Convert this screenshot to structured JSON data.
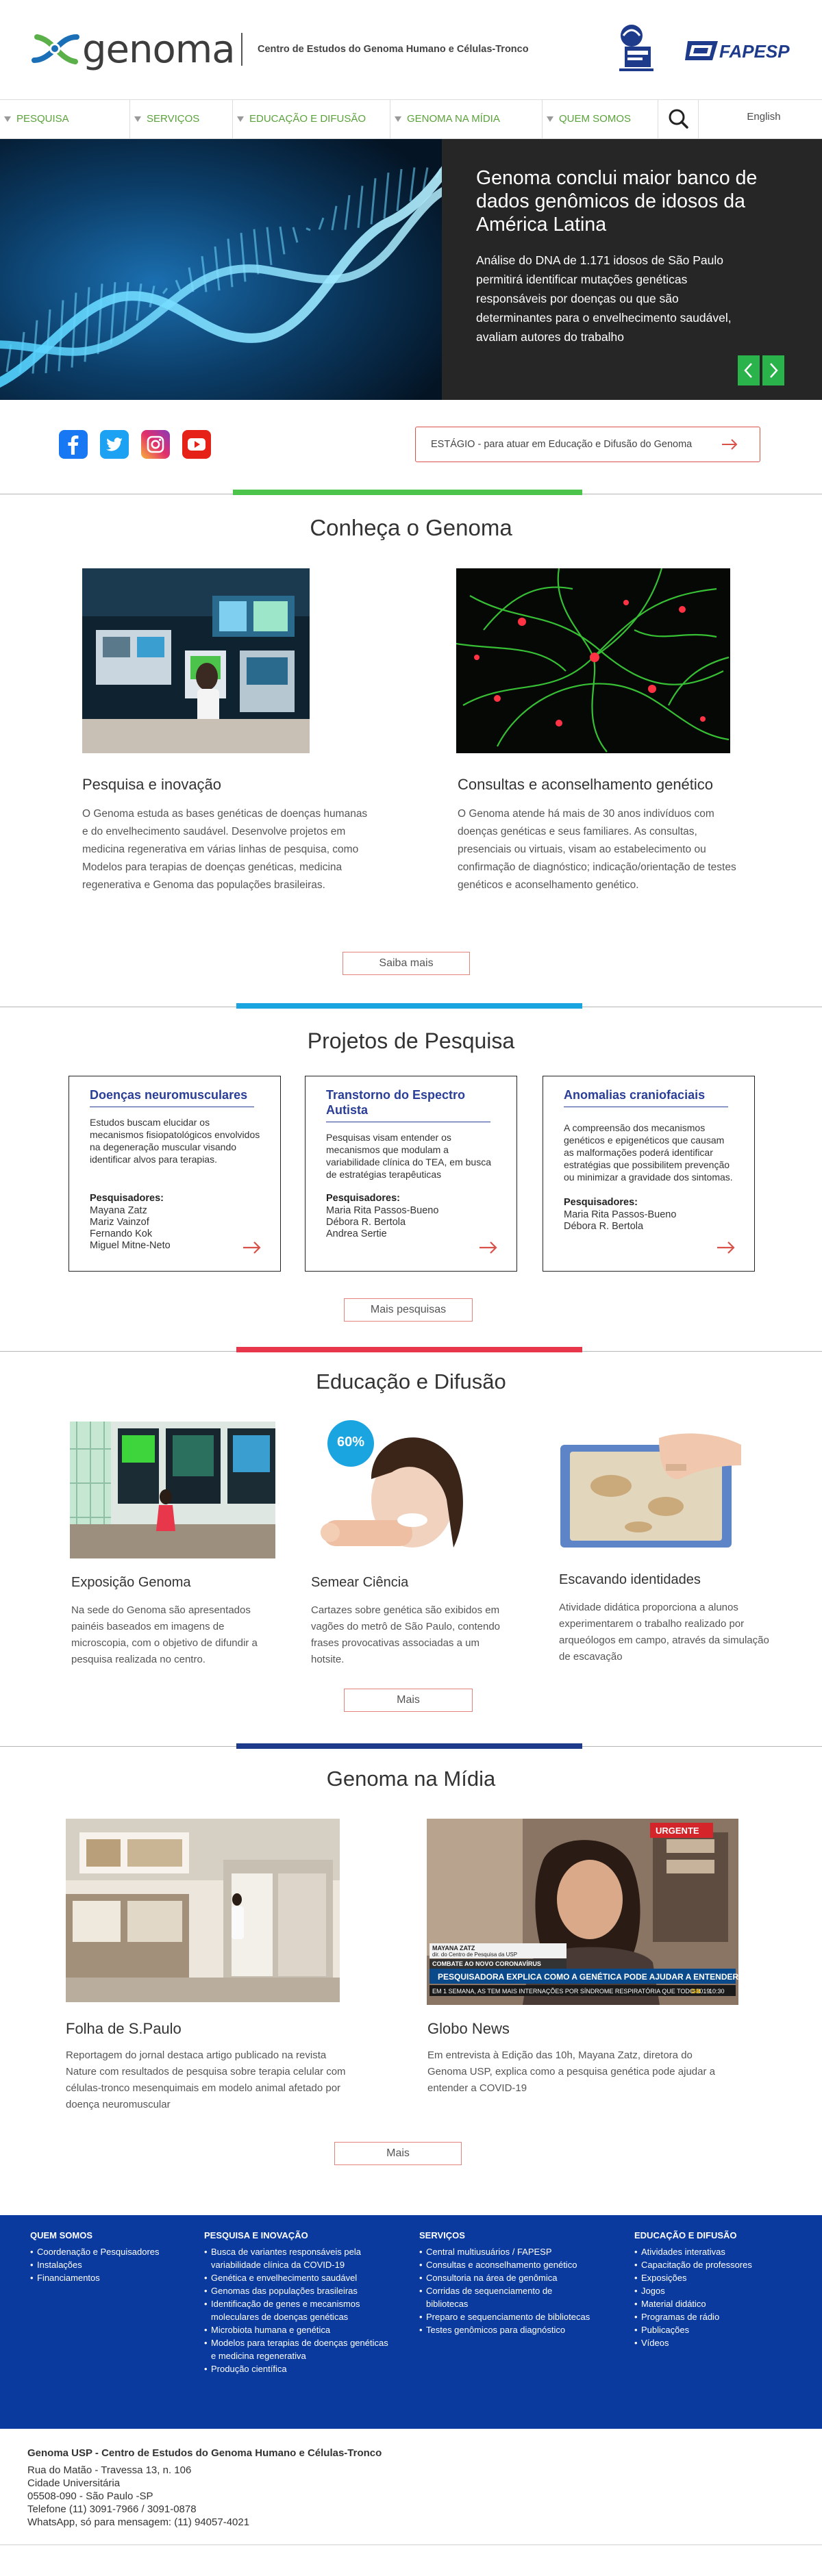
{
  "header": {
    "logo_text": "genoma",
    "center_name": "Centro de Estudos do Genoma Humano e Células-Tronco",
    "partner_logo": "institution-seal-logo",
    "fapesp_text": "FAPESP"
  },
  "nav": {
    "items": [
      "PESQUISA",
      "SERVIÇOS",
      "EDUCAÇÃO E DIFUSÃO",
      "GENOMA NA MÍDIA",
      "QUEM SOMOS"
    ],
    "language": "English",
    "search_icon": "search-icon"
  },
  "hero": {
    "title": "Genoma conclui maior banco de dados genômicos de idosos da América Latina",
    "text": "Análise do DNA de 1.171 idosos de São Paulo permitirá identificar mutações genéticas responsáveis por doenças ou que são determinantes para o envelhecimento saudável, avaliam autores do trabalho",
    "prev_icon": "chevron-left-icon",
    "next_icon": "chevron-right-icon"
  },
  "social": {
    "icons": [
      "facebook-icon",
      "twitter-icon",
      "instagram-icon",
      "youtube-icon"
    ],
    "estagio_label": "ESTÁGIO - para atuar em Educação e Difusão do Genoma"
  },
  "conheca": {
    "title": "Conheça o Genoma",
    "bar_color": "#4cc34a",
    "cards": [
      {
        "title": "Pesquisa e inovação",
        "text": "O Genoma estuda as bases genéticas de doenças humanas e do envelhecimento saudável. Desenvolve projetos em medicina regenerativa em várias linhas de pesquisa, como Modelos para terapias de doenças genéticas, medicina regenerativa e Genoma das populações brasileiras."
      },
      {
        "title": "Consultas e aconselhamento genético",
        "text": "O Genoma atende há mais de 30 anos indivíduos com doenças genéticas e seus familiares. As consultas, presenciais ou virtuais, visam ao estabelecimento ou confirmação de diagnóstico; indicação/orientação de testes genéticos e aconselhamento genético."
      }
    ],
    "more_label": "Saiba mais"
  },
  "projetos": {
    "title": "Projetos de Pesquisa",
    "bar_color": "#1aa5e0",
    "researchers_label": "Pesquisadores:",
    "cards": [
      {
        "title": "Doenças neuromusculares",
        "desc": "Estudos buscam elucidar os mecanismos fisiopatológicos envolvidos na degeneração muscular visando identificar alvos para terapias.",
        "names": [
          "Mayana Zatz",
          "Mariz  Vainzof",
          "Fernando Kok",
          "Miguel Mitne-Neto"
        ]
      },
      {
        "title": "Transtorno do Espectro Autista",
        "desc": "Pesquisas visam entender os mecanismos que modulam a variabilidade clínica do TEA, em busca de estratégias terapêuticas",
        "names": [
          "Maria Rita Passos-Bueno",
          "Débora R. Bertola",
          "Andrea Sertie"
        ]
      },
      {
        "title": "Anomalias craniofaciais",
        "desc": "A compreensão dos mecanismos genéticos e epigenéticos que causam as malformações poderá identificar estratégias que possibilitem prevenção ou minimizar a gravidade dos sintomas.",
        "names": [
          "Maria Rita Passos-Bueno",
          "Débora R. Bertola"
        ]
      }
    ],
    "more_label": "Mais pesquisas"
  },
  "educacao": {
    "title": "Educação e Difusão",
    "bar_color": "#e8374a",
    "cards": [
      {
        "title": "Exposição Genoma",
        "text": "Na sede do Genoma são apresentados painéis baseados em imagens de microscopia, com o objetivo de difundir a pesquisa realizada no centro."
      },
      {
        "title": "Semear Ciência",
        "text": "Cartazes sobre genética são exibidos em vagões do metrô de São Paulo, contendo frases provocativas associadas a um hotsite."
      },
      {
        "title": "Escavando identidades",
        "text": "Atividade didática proporciona a alunos experimentarem o trabalho realizado por arqueólogos em campo, através da simulação de escavação"
      }
    ],
    "poster_badge": "60%",
    "more_label": "Mais"
  },
  "midia": {
    "title": "Genoma na Mídia",
    "bar_color": "#1e3a8a",
    "cards": [
      {
        "title": "Folha de S.Paulo",
        "text": "Reportagem do jornal destaca artigo publicado na revista Nature com resultados de pesquisa sobre terapia celular com células-tronco mesenquimais em modelo animal afetado por doença neuromuscular"
      },
      {
        "title": "Globo News",
        "text": "Em entrevista à Edição das 10h, Mayana Zatz, diretora do Genoma USP, explica como a pesquisa genética pode ajudar a entender a COVID-19"
      }
    ],
    "tv": {
      "urgent": "URGENTE",
      "caption_name": "MAYANA ZATZ",
      "caption_role": "dir. do Centro de Pesquisa da USP",
      "banner_tag": "COMBATE AO NOVO CORONAVÍRUS",
      "headline": "PESQUISADORA EXPLICA COMO A GENÉTICA PODE AJUDAR A ENTENDER A DOENÇA",
      "ticker": "EM 1 SEMANA, AS TEM MAIS INTERNAÇÕES POR SÍNDROME RESPIRATÓRIA QUE TODO 2019",
      "channel": "GN",
      "clock": "10:30"
    },
    "more_label": "Mais"
  },
  "footer": {
    "cols": [
      {
        "heading": "QUEM SOMOS",
        "items": [
          "Coordenação e Pesquisadores",
          "Instalações",
          "Financiamentos"
        ]
      },
      {
        "heading": "PESQUISA E INOVAÇÃO",
        "items": [
          "Busca de variantes responsáveis pela variabilidade clínica da COVID-19",
          "Genética e envelhecimento saudável",
          "Genomas das populações brasileiras",
          "Identificação de genes e mecanismos moleculares de doenças genéticas",
          "Microbiota humana e genética",
          "Modelos para terapias de doenças genéticas e medicina regenerativa",
          "Produção científica"
        ]
      },
      {
        "heading": "SERVIÇOS",
        "items": [
          "Central multiusuários / FAPESP",
          "Consultas e aconselhamento genético",
          "Consultoria na área de genômica",
          "Corridas de sequenciamento de bibliotecas",
          "Preparo e sequenciamento de bibliotecas",
          "Testes genômicos para diagnóstico"
        ]
      },
      {
        "heading": "EDUCAÇÃO E DIFUSÃO",
        "items": [
          "Atividades interativas",
          "Capacitação de professores",
          "Exposições",
          "Jogos",
          "Material didático",
          "Programas de rádio",
          "Publicações",
          "Vídeos"
        ]
      }
    ]
  },
  "address": {
    "title": "Genoma USP - Centro de Estudos do Genoma Humano e Células-Tronco",
    "lines": [
      "Rua do Matão - Travessa 13, n. 106",
      "Cidade Universitária",
      "05508-090 - São Paulo -SP",
      "Telefone (11) 3091-7966 / 3091-0878",
      "WhatsApp, só para mensagem: (11) 94057-4021"
    ]
  }
}
